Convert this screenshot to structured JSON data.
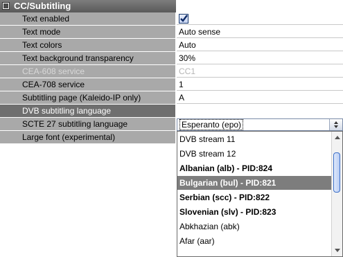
{
  "section": {
    "title": "CC/Subtitling"
  },
  "rows": [
    {
      "label": "Text enabled",
      "value": "",
      "checked": true
    },
    {
      "label": "Text mode",
      "value": "Auto sense"
    },
    {
      "label": "Text colors",
      "value": "Auto"
    },
    {
      "label": "Text background transparency",
      "value": "30%"
    },
    {
      "label": "CEA-608 service",
      "value": "CC1",
      "disabled": true
    },
    {
      "label": "CEA-708 service",
      "value": "1"
    },
    {
      "label": "Subtitling page (Kaleido-IP only)",
      "value": "A"
    },
    {
      "label": "DVB subtitling language",
      "value": "Esperanto (epo)",
      "selected": true
    },
    {
      "label": "SCTE 27 subtitling language",
      "value": ""
    },
    {
      "label": "Large font (experimental)",
      "value": ""
    }
  ],
  "dropdown": {
    "current": "Esperanto (epo)",
    "options": [
      {
        "text": "DVB stream 11",
        "bold": false
      },
      {
        "text": "DVB stream 12",
        "bold": false
      },
      {
        "text": "Albanian (alb) - PID:824",
        "bold": true
      },
      {
        "text": "Bulgarian (bul) - PID:821",
        "bold": true,
        "highlighted": true
      },
      {
        "text": "Serbian (scc) - PID:822",
        "bold": true
      },
      {
        "text": "Slovenian (slv) - PID:823",
        "bold": true
      },
      {
        "text": "Abkhazian (abk)",
        "bold": false
      },
      {
        "text": "Afar (aar)",
        "bold": false
      }
    ]
  }
}
